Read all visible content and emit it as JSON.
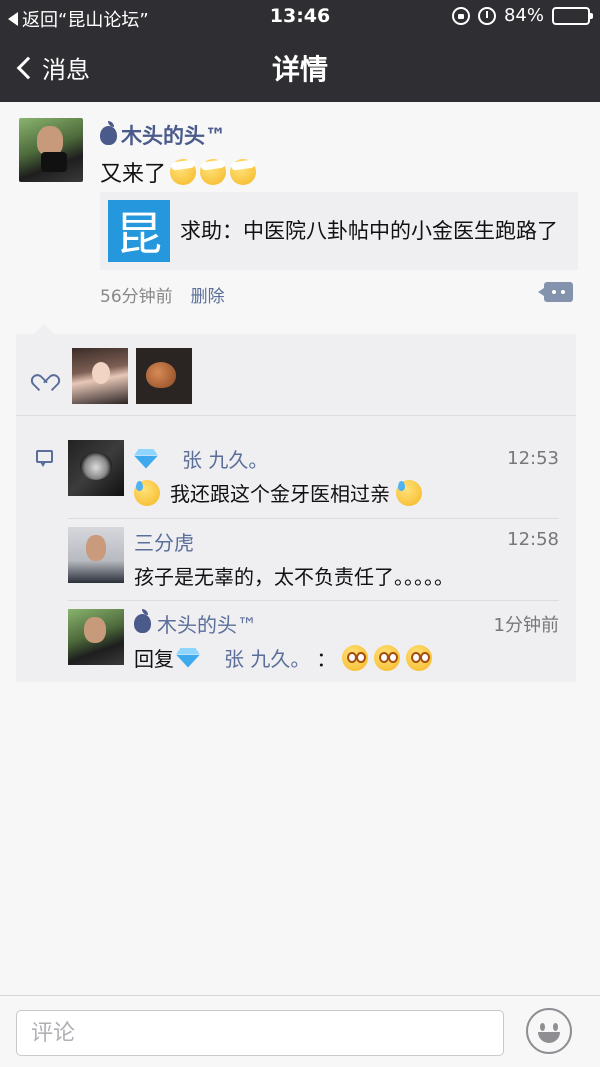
{
  "status_bar": {
    "back_app": "返回“昆山论坛”",
    "time": "13:46",
    "battery": "84%",
    "battery_level": 0.84
  },
  "nav": {
    "back_label": "消息",
    "title": "详情"
  },
  "post": {
    "author": "木头的头™",
    "text": "又来了",
    "text_emojis": [
      "bandage-face-emoji",
      "bandage-face-emoji",
      "bandage-face-emoji"
    ],
    "link": {
      "thumb_char": "昆",
      "title": "求助：中医院八卦帖中的小金医生跑路了"
    },
    "time_ago": "56分钟前",
    "delete_label": "删除"
  },
  "likes": {
    "avatars": [
      "woman-portrait",
      "teapot"
    ]
  },
  "comments": [
    {
      "name": "张 九久。",
      "time": "12:53",
      "text": "我还跟这个金牙医相过亲",
      "name_icon": "diamond-icon",
      "text_emojis": [
        "sweat-face-emoji",
        "sweat-face-emoji"
      ]
    },
    {
      "name": "三分虎",
      "time": "12:58",
      "text": "孩子是无辜的，太不负责任了。。。。。"
    },
    {
      "name": "木头的头™",
      "time": "1分钟前",
      "reply_prefix": "回复",
      "reply_to": "张 九久。",
      "reply_suffix": "：",
      "text_emojis": [
        "flushed-face-emoji",
        "flushed-face-emoji",
        "flushed-face-emoji"
      ]
    }
  ],
  "input": {
    "placeholder": "评论"
  },
  "colors": {
    "nav_bg": "#2f2f33",
    "link_blue": "#5a6e99",
    "panel_bg": "#efeff2"
  }
}
